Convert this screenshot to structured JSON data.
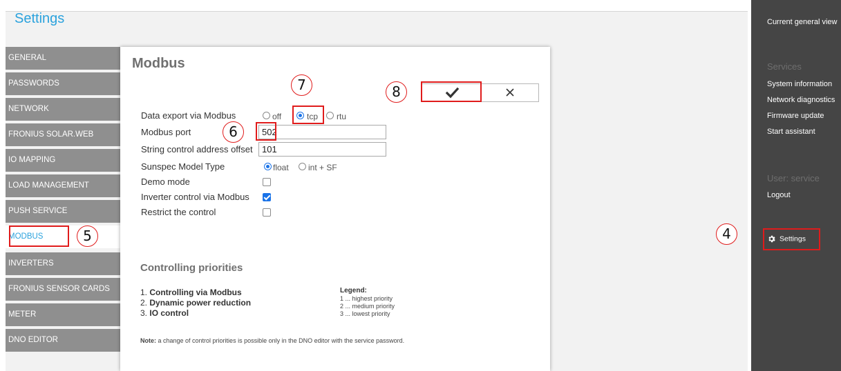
{
  "app": {
    "title": "Settings"
  },
  "nav": {
    "items": [
      {
        "label": "GENERAL"
      },
      {
        "label": "PASSWORDS"
      },
      {
        "label": "NETWORK"
      },
      {
        "label": "FRONIUS SOLAR.WEB"
      },
      {
        "label": "IO MAPPING"
      },
      {
        "label": "LOAD MANAGEMENT"
      },
      {
        "label": "PUSH SERVICE"
      },
      {
        "label": "MODBUS",
        "active": true
      },
      {
        "label": "INVERTERS"
      },
      {
        "label": "FRONIUS SENSOR CARDS"
      },
      {
        "label": "METER"
      },
      {
        "label": "DNO EDITOR"
      }
    ]
  },
  "panel": {
    "title": "Modbus",
    "data_export": {
      "label": "Data export via Modbus",
      "options": [
        "off",
        "tcp",
        "rtu"
      ],
      "selected": "tcp"
    },
    "modbus_port": {
      "label": "Modbus port",
      "value": "502"
    },
    "string_offset": {
      "label": "String control address offset",
      "value": "101"
    },
    "sunspec": {
      "label": "Sunspec Model Type",
      "options": [
        "float",
        "int + SF"
      ],
      "selected": "float"
    },
    "demo_mode": {
      "label": "Demo mode",
      "checked": false
    },
    "inverter_control": {
      "label": "Inverter control via Modbus",
      "checked": true
    },
    "restrict_control": {
      "label": "Restrict the control",
      "checked": false
    },
    "confirm_icon": "checkmark-icon",
    "cancel_icon": "close-icon"
  },
  "priorities": {
    "title": "Controlling priorities",
    "items": [
      {
        "num": "1.",
        "label": "Controlling via Modbus"
      },
      {
        "num": "2.",
        "label": "Dynamic power reduction"
      },
      {
        "num": "3.",
        "label": "IO control"
      }
    ],
    "legend_title": "Legend:",
    "legend_items": [
      "1 ... highest priority",
      "2 ... medium priority",
      "3 ... lowest priority"
    ],
    "note_bold": "Note:",
    "note_text": " a change of control priorities is possible only in the DNO editor with the service password."
  },
  "sidebar": {
    "current_view": "Current general view",
    "services_heading": "Services",
    "services": [
      "System information",
      "Network diagnostics",
      "Firmware update",
      "Start assistant"
    ],
    "user_heading": "User: service",
    "logout": "Logout",
    "settings": "Settings",
    "settings_icon": "gear-icon"
  },
  "annotations": [
    "4",
    "5",
    "6",
    "7",
    "8"
  ],
  "colors": {
    "accent": "#2aa2dd",
    "highlight": "#e01b1b",
    "sidebar": "#454545",
    "nav": "#8f8f8f"
  }
}
